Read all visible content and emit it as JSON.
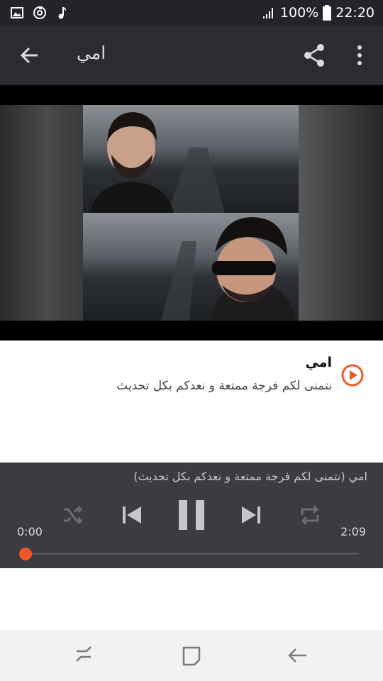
{
  "status_bar": {
    "icons_left": [
      "image-icon",
      "sync-circle-icon",
      "music-note-icon"
    ],
    "signal_icon": "signal-bars-icon",
    "battery_percent": "100%",
    "battery_icon": "battery-icon",
    "time": "22:20"
  },
  "app_bar": {
    "title": "امي",
    "back_icon": "arrow-back-icon",
    "share_icon": "share-icon",
    "menu_icon": "more-vert-icon"
  },
  "video": {
    "content": "video-thumbnail-two-singers"
  },
  "track": {
    "title": "امي",
    "subtitle": "نتمنى لكم فرجة ممتعة و نعدكم بكل تحديث",
    "play_icon": "play-circle-icon"
  },
  "player": {
    "now_playing": "امي (نتمنى لكم فرجة ممتعة و نعدكم بكل تحديث)",
    "time_current": "0:00",
    "time_total": "2:09",
    "progress": 0.0,
    "controls": [
      "shuffle-icon",
      "skip-previous-icon",
      "pause-icon",
      "skip-next-icon",
      "repeat-icon"
    ],
    "accent_color": "#F25526"
  },
  "nav_bar": {
    "buttons": [
      "recent-apps-icon",
      "home-icon",
      "back-icon"
    ]
  }
}
